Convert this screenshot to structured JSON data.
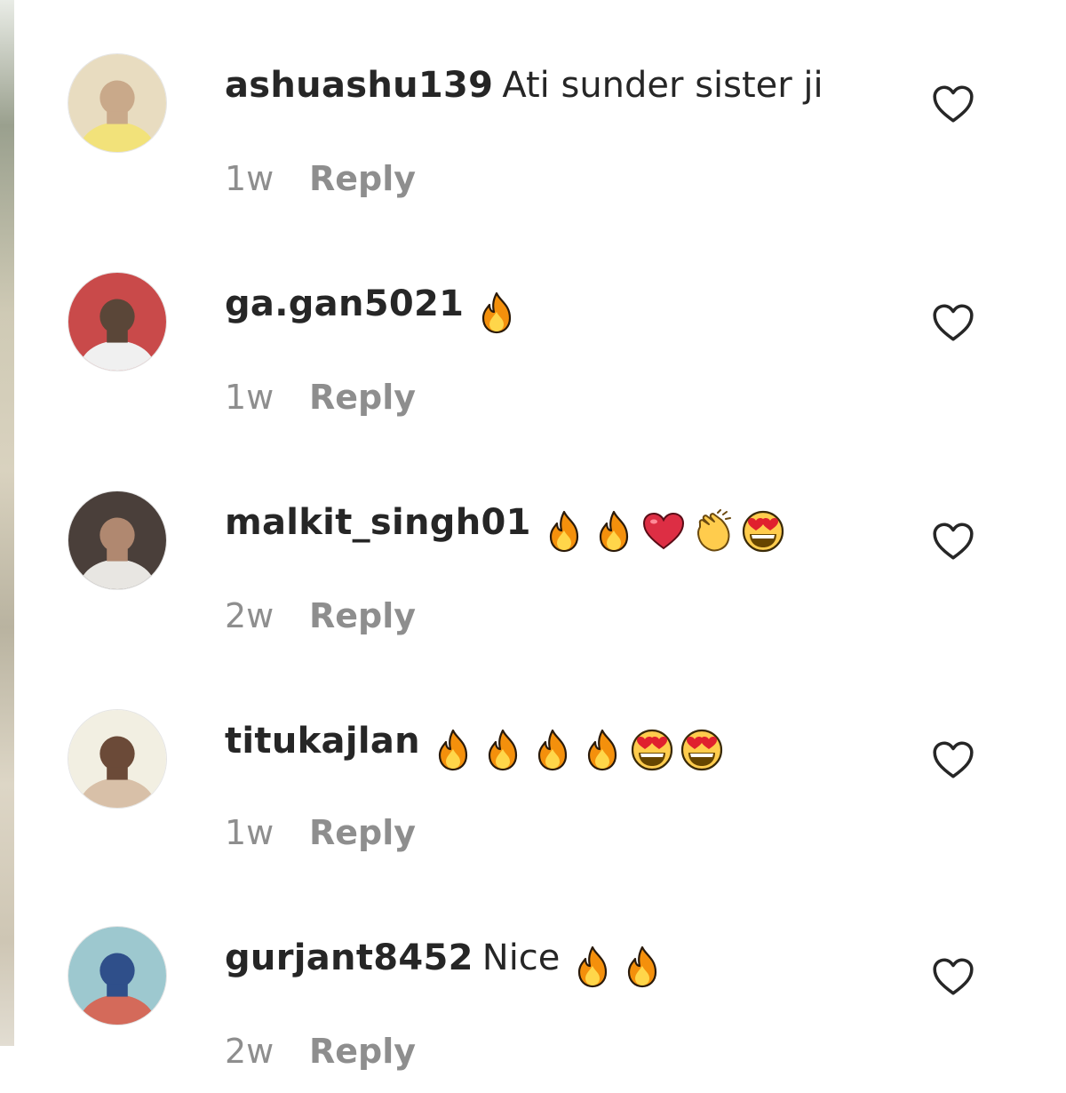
{
  "comments": [
    {
      "username": "ashuashu139",
      "text": "Ati sunder sister ji",
      "emojis": [],
      "time": "1w",
      "reply_label": "Reply",
      "avatar_colors": [
        "#e8dcc0",
        "#f2e27a",
        "#c9a98a"
      ]
    },
    {
      "username": "ga.gan5021",
      "text": "",
      "emojis": [
        "fire-emoji"
      ],
      "time": "1w",
      "reply_label": "Reply",
      "avatar_colors": [
        "#c94a4a",
        "#f0f0f0",
        "#5a4638"
      ]
    },
    {
      "username": "malkit_singh01",
      "text": "",
      "emojis": [
        "fire-emoji",
        "fire-emoji",
        "red-heart-emoji",
        "clapping-hands-emoji",
        "heart-eyes-emoji"
      ],
      "time": "2w",
      "reply_label": "Reply",
      "avatar_colors": [
        "#4a3f3a",
        "#e8e6e2",
        "#b08870"
      ]
    },
    {
      "username": "titukajlan",
      "text": "",
      "emojis": [
        "fire-emoji",
        "fire-emoji",
        "fire-emoji",
        "fire-emoji",
        "heart-eyes-emoji",
        "heart-eyes-emoji"
      ],
      "time": "1w",
      "reply_label": "Reply",
      "avatar_colors": [
        "#f2efe2",
        "#d8c0a8",
        "#6b4a38"
      ]
    },
    {
      "username": "gurjant8452",
      "text": "Nice",
      "emojis": [
        "fire-emoji",
        "fire-emoji"
      ],
      "time": "2w",
      "reply_label": "Reply",
      "avatar_colors": [
        "#9dc8cf",
        "#d46a5a",
        "#2f4f8a"
      ]
    }
  ],
  "colors": {
    "text_primary": "#262626",
    "text_secondary": "#8e8e8e",
    "background": "#ffffff"
  }
}
